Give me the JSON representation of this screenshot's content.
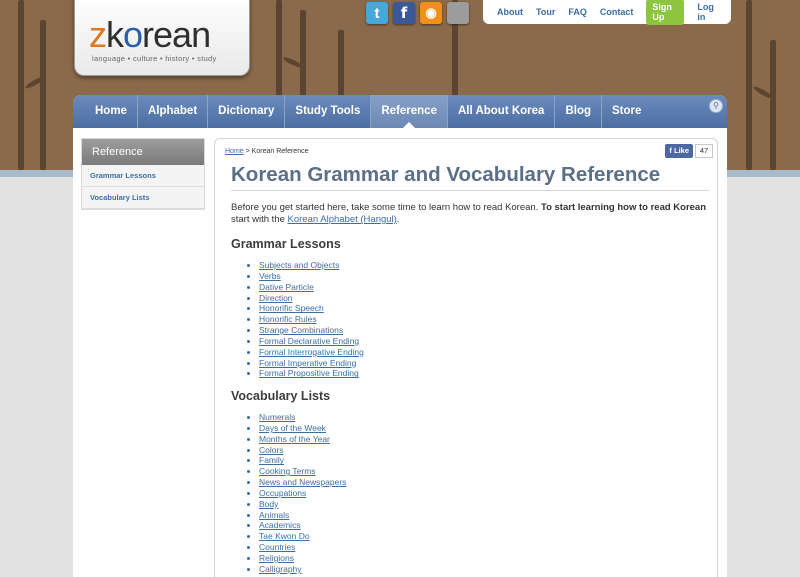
{
  "logo": {
    "name_z": "z",
    "name_k": "k",
    "name_o": "o",
    "name_rest": "rean",
    "tagline": "language • culture • history • study"
  },
  "social": [
    {
      "icon": "twitter-icon",
      "glyph": "t"
    },
    {
      "icon": "facebook-icon",
      "glyph": "f"
    },
    {
      "icon": "rss-icon",
      "glyph": "◉"
    },
    {
      "icon": "other-icon",
      "glyph": ""
    }
  ],
  "toplinks": {
    "about": "About",
    "tour": "Tour",
    "faq": "FAQ",
    "contact": "Contact",
    "signup": "Sign Up",
    "login": "Log in"
  },
  "nav": [
    "Home",
    "Alphabet",
    "Dictionary",
    "Study Tools",
    "Reference",
    "All About Korea",
    "Blog",
    "Store"
  ],
  "nav_active": "Reference",
  "sidebar": {
    "heading": "Reference",
    "items": [
      "Grammar Lessons",
      "Vocabulary Lists"
    ]
  },
  "breadcrumb": {
    "home": "Home",
    "sep": " > ",
    "current": "Korean Reference"
  },
  "fb": {
    "like": "Like",
    "count": "47"
  },
  "page_title": "Korean Grammar and Vocabulary Reference",
  "intro": {
    "part1": "Before you get started here, take some time to learn how to read Korean. ",
    "bold": "To start learning how to read Korean",
    "part2": " start with the ",
    "link": "Korean Alphabet (Hangul)",
    "part3": "."
  },
  "grammar": {
    "heading": "Grammar Lessons",
    "items": [
      "Subjects and Objects",
      "Verbs",
      "Dative Particle",
      "Direction",
      "Honorific Speech",
      "Honorific Rules",
      "Strange Combinations",
      "Formal Declarative Ending",
      "Formal Interrogative Ending",
      "Formal Imperative Ending",
      "Formal Propositive Ending"
    ]
  },
  "vocab": {
    "heading": "Vocabulary Lists",
    "items": [
      "Numerals",
      "Days of the Week",
      "Months of the Year",
      "Colors",
      "Family",
      "Cooking Terms",
      "News and Newspapers",
      "Occupations",
      "Body",
      "Animals",
      "Academics",
      "Tae Kwon Do",
      "Countries",
      "Religions",
      "Calligraphy"
    ]
  }
}
